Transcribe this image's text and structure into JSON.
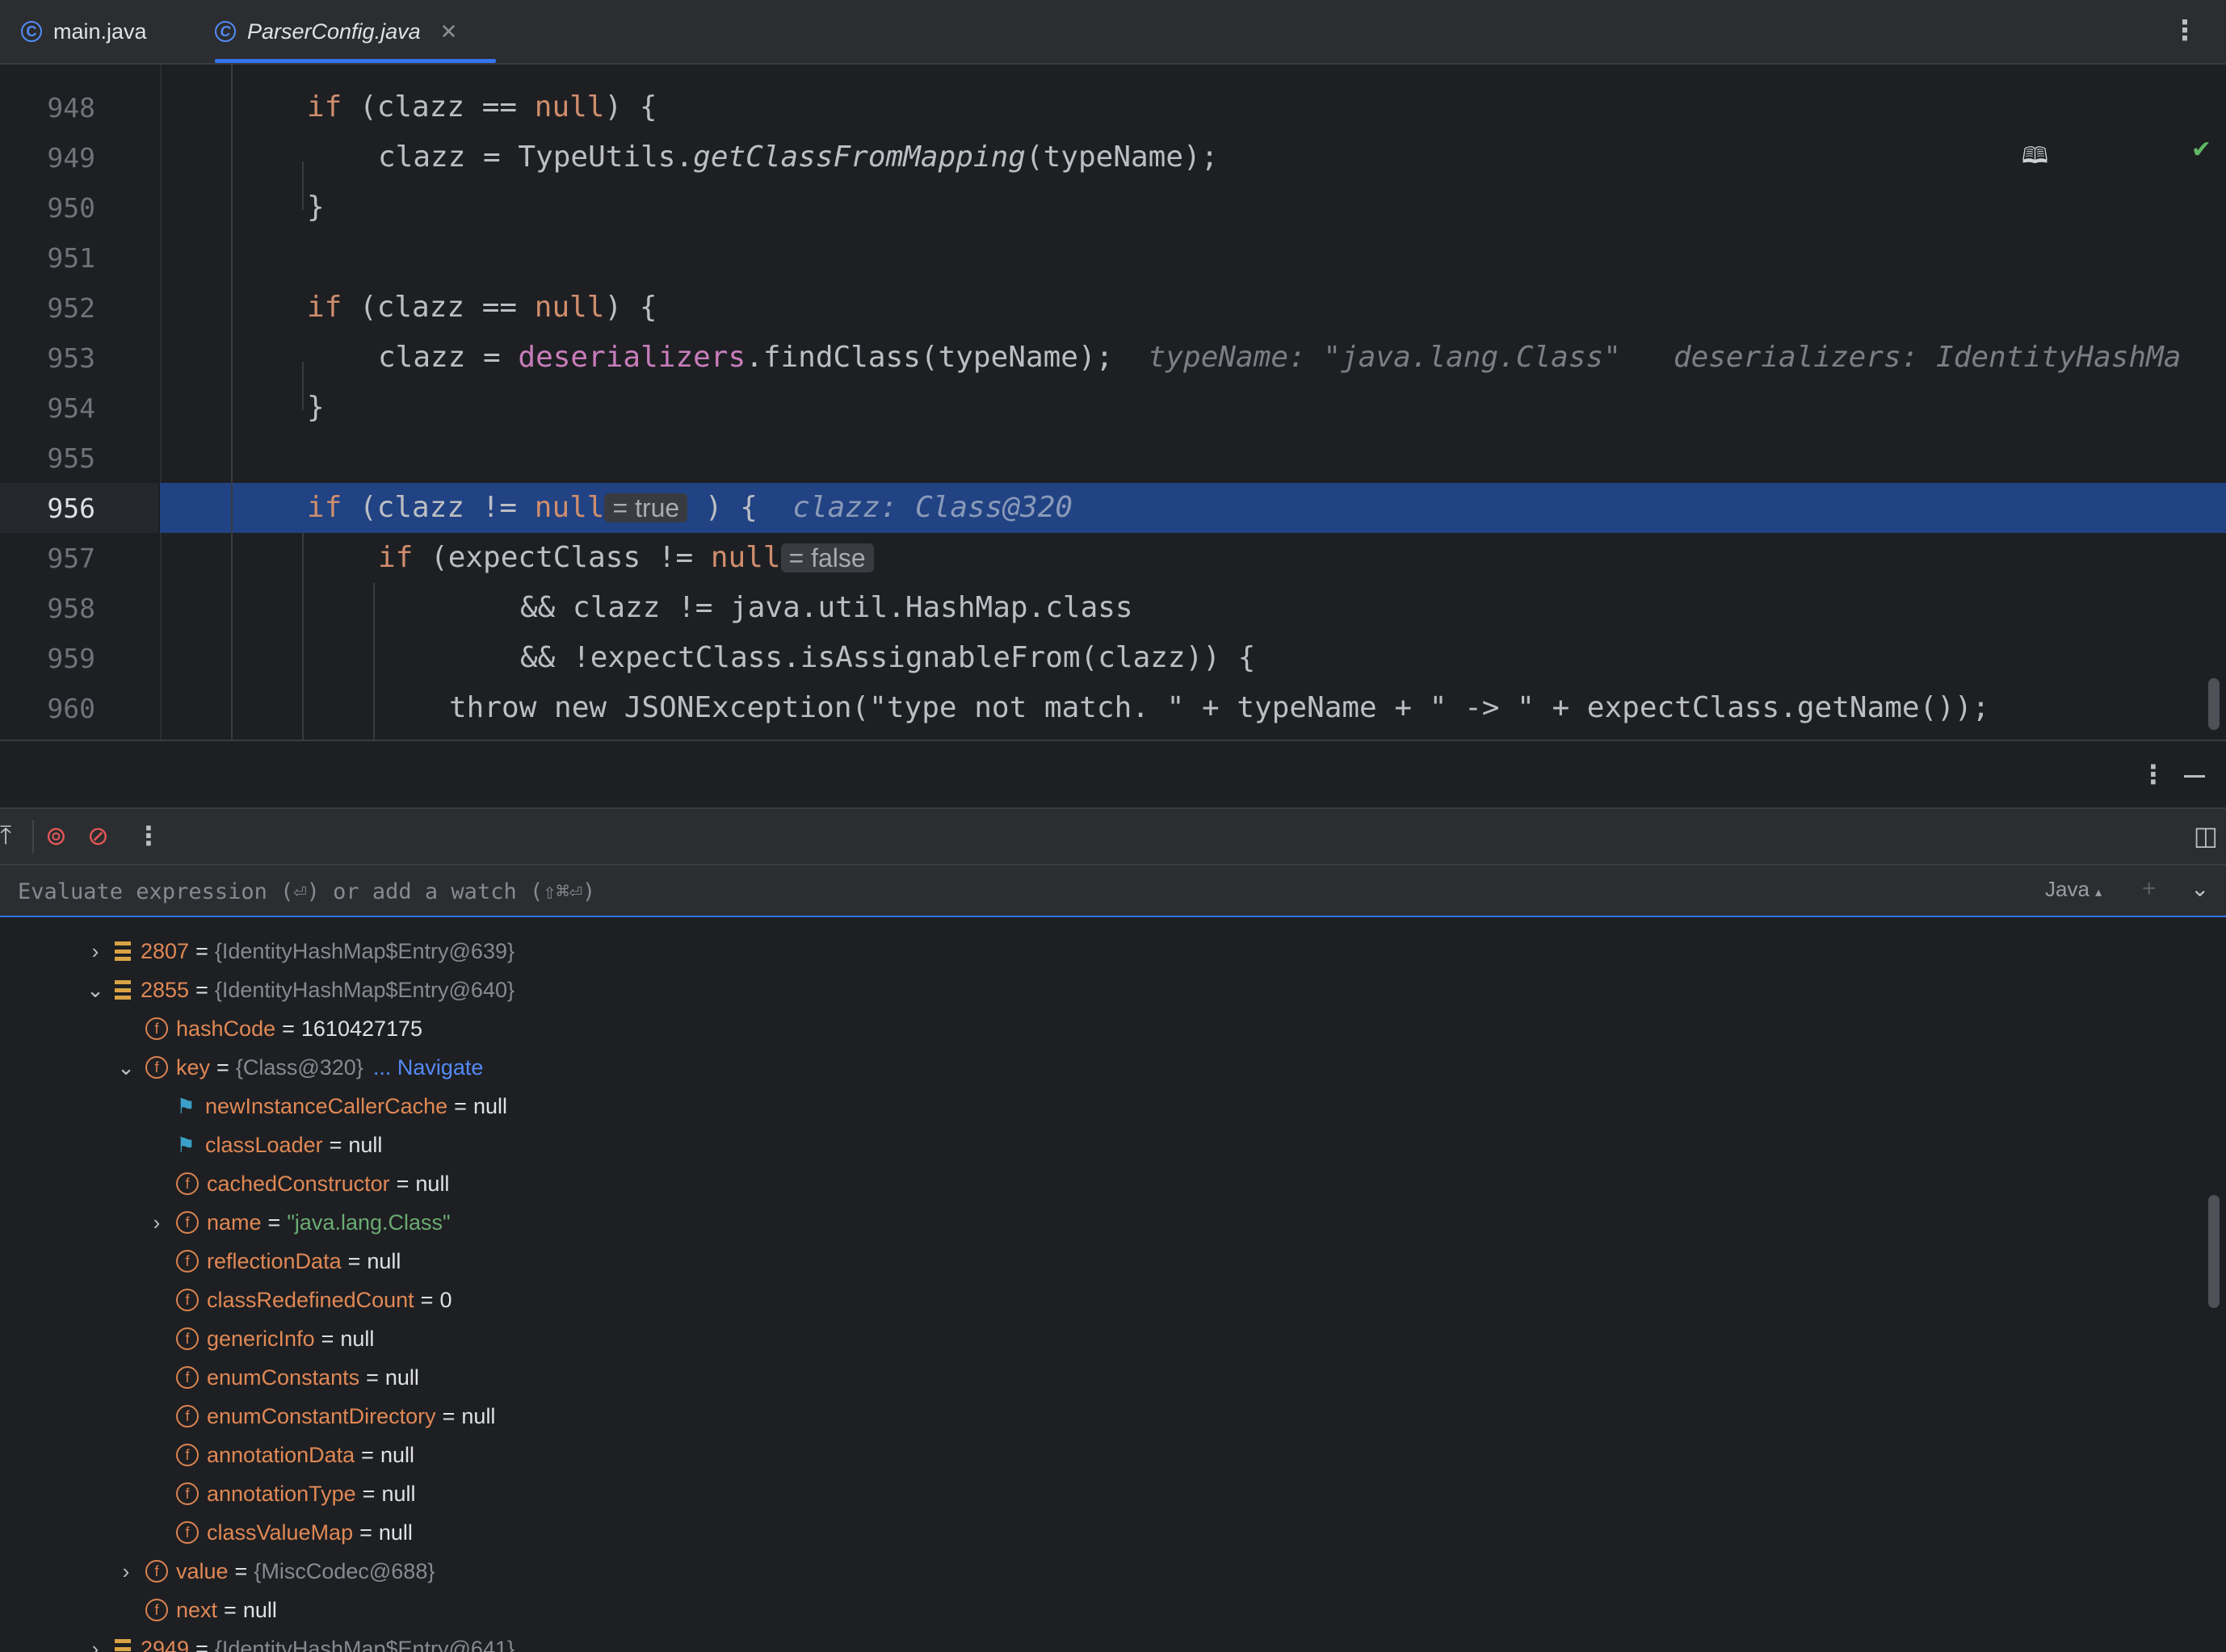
{
  "tabs": [
    {
      "label": "main.java"
    },
    {
      "label": "ParserConfig.java"
    }
  ],
  "editor": {
    "line_numbers": [
      "948",
      "949",
      "950",
      "951",
      "952",
      "953",
      "954",
      "955",
      "956",
      "957",
      "958",
      "959",
      "960"
    ],
    "lines": {
      "l948": {
        "kw": "if",
        "rest1": " (clazz == ",
        "kw2": "null",
        "rest2": ") {"
      },
      "l949": {
        "a": "clazz = TypeUtils.",
        "b": "getClassFromMapping",
        "c": "(typeName);"
      },
      "l950": {
        "a": "}"
      },
      "l952": {
        "kw": "if",
        "rest1": " (clazz == ",
        "kw2": "null",
        "rest2": ") {"
      },
      "l953": {
        "a": "clazz = ",
        "field": "deserializers",
        "c": ".findClass(typeName);",
        "hint1": "typeName: \"java.lang.Class\"",
        "hint2": "deserializers: IdentityHashMa"
      },
      "l954": {
        "a": "}"
      },
      "l956": {
        "kw": "if",
        "rest1": " (clazz != ",
        "kw2": "null",
        "inline": "= true",
        "rest2": " ) {",
        "hint": "clazz: Class@320"
      },
      "l957": {
        "kw": "if",
        "rest1": " (expectClass != ",
        "kw2": "null",
        "inline": "= false"
      },
      "l958": {
        "a": "&& clazz != java.util.HashMap.class"
      },
      "l959": {
        "a": "&& !expectClass.isAssignableFrom(clazz)) {"
      },
      "l960": {
        "a": "throw new JSONException(\"type not match. \" + typeName + \" -> \" + expectClass.getName());"
      }
    }
  },
  "debugger": {
    "eval_placeholder": "Evaluate expression (⏎) or add a watch (⇧⌘⏎)",
    "language": "Java",
    "tree": [
      {
        "indent": 0,
        "arrow": "›",
        "icon": "array",
        "name": "2807",
        "value": "{IdentityHashMap$Entry@639}"
      },
      {
        "indent": 0,
        "arrow": "⌄",
        "icon": "array",
        "name": "2855",
        "value": "{IdentityHashMap$Entry@640}"
      },
      {
        "indent": 1,
        "arrow": "",
        "icon": "field",
        "name": "hashCode",
        "value": "1610427175"
      },
      {
        "indent": 1,
        "arrow": "⌄",
        "icon": "field",
        "name": "key",
        "value": "{Class@320}",
        "navigate": "... Navigate"
      },
      {
        "indent": 2,
        "arrow": "",
        "icon": "flag",
        "name": "newInstanceCallerCache",
        "value": "null"
      },
      {
        "indent": 2,
        "arrow": "",
        "icon": "flag",
        "name": "classLoader",
        "value": "null"
      },
      {
        "indent": 2,
        "arrow": "",
        "icon": "field",
        "name": "cachedConstructor",
        "value": "null"
      },
      {
        "indent": 2,
        "arrow": "›",
        "icon": "field",
        "name": "name",
        "value": "\"java.lang.Class\""
      },
      {
        "indent": 2,
        "arrow": "",
        "icon": "field",
        "name": "reflectionData",
        "value": "null"
      },
      {
        "indent": 2,
        "arrow": "",
        "icon": "field",
        "name": "classRedefinedCount",
        "value": "0"
      },
      {
        "indent": 2,
        "arrow": "",
        "icon": "field",
        "name": "genericInfo",
        "value": "null"
      },
      {
        "indent": 2,
        "arrow": "",
        "icon": "field",
        "name": "enumConstants",
        "value": "null"
      },
      {
        "indent": 2,
        "arrow": "",
        "icon": "field",
        "name": "enumConstantDirectory",
        "value": "null"
      },
      {
        "indent": 2,
        "arrow": "",
        "icon": "field",
        "name": "annotationData",
        "value": "null"
      },
      {
        "indent": 2,
        "arrow": "",
        "icon": "field",
        "name": "annotationType",
        "value": "null"
      },
      {
        "indent": 2,
        "arrow": "",
        "icon": "field",
        "name": "classValueMap",
        "value": "null"
      },
      {
        "indent": 1,
        "arrow": "›",
        "icon": "field",
        "name": "value",
        "value": "{MiscCodec@688}"
      },
      {
        "indent": 1,
        "arrow": "",
        "icon": "field",
        "name": "next",
        "value": "null"
      },
      {
        "indent": 0,
        "arrow": "›",
        "icon": "array",
        "name": "2949",
        "value": "{IdentityHashMap$Entry@641}"
      }
    ]
  },
  "colors": {
    "accent": "#3574f0",
    "selection": "#214283",
    "keyword": "#cf8e6d",
    "field": "#c77dbb",
    "string": "#6aab73"
  }
}
